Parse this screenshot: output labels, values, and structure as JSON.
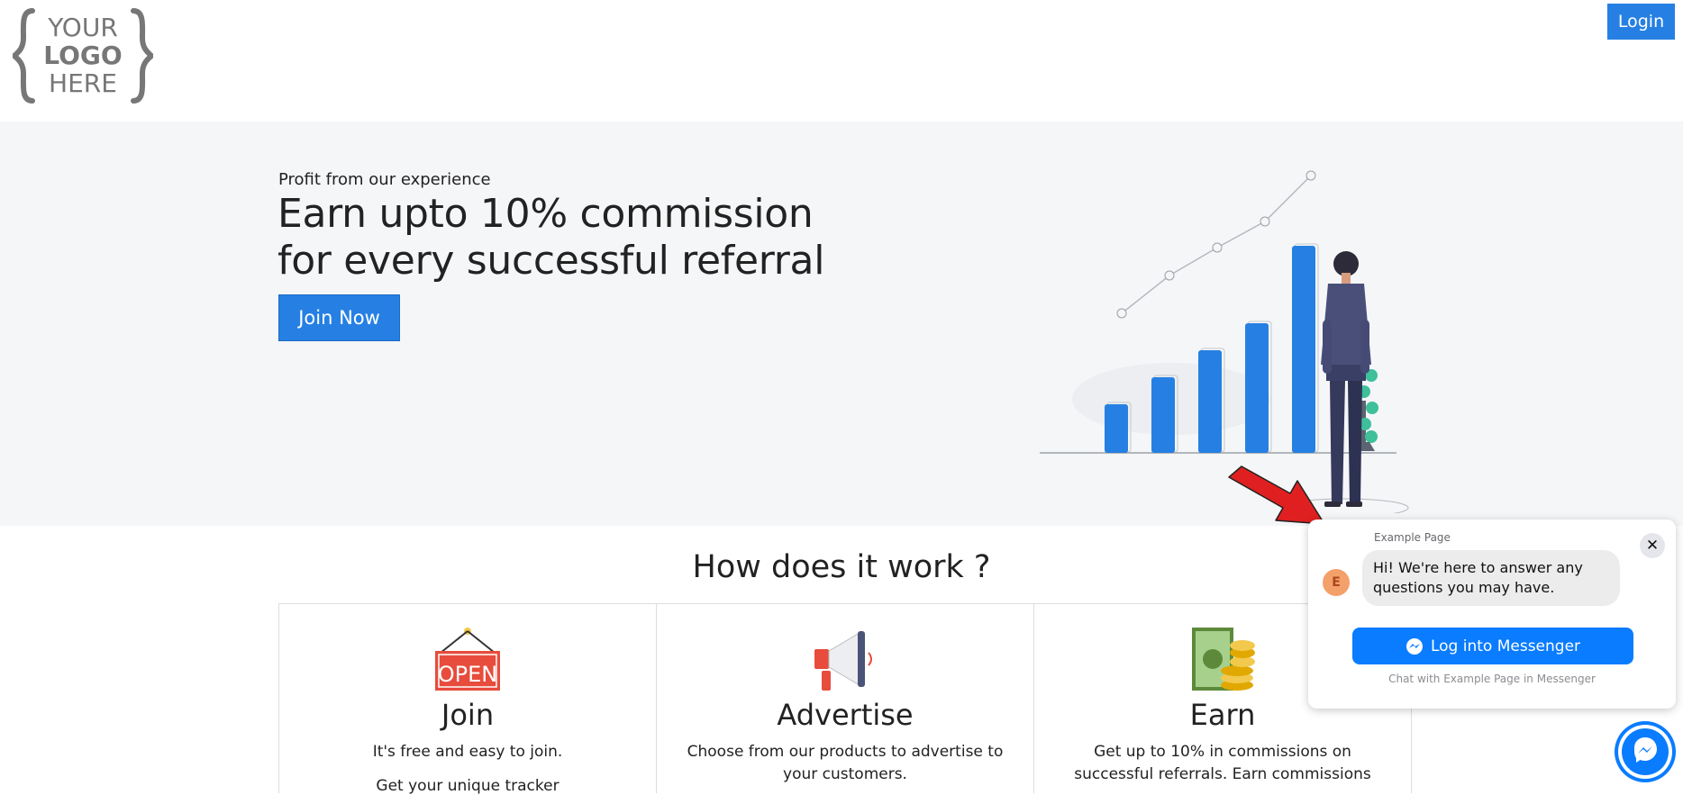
{
  "header": {
    "logo": {
      "line1": "YOUR",
      "line2": "LOGO",
      "line3": "HERE"
    },
    "login_label": "Login"
  },
  "hero": {
    "eyebrow": "Profit from our experience",
    "headline_line1": "Earn upto 10% commission",
    "headline_line2": "for every successful referral",
    "join_label": "Join Now"
  },
  "how": {
    "title": "How does it work ?",
    "cards": [
      {
        "icon": "open-sign-icon",
        "title": "Join",
        "text": "It's free and easy to join.",
        "text2": "Get your unique tracker"
      },
      {
        "icon": "megaphone-icon",
        "title": "Advertise",
        "text": "Choose from our products to advertise to your customers.",
        "text2": ""
      },
      {
        "icon": "money-coins-icon",
        "title": "Earn",
        "text": "Get up to 10% in commissions on successful referrals. Earn commissions",
        "text2": ""
      }
    ]
  },
  "messenger": {
    "page_name": "Example Page",
    "avatar_initial": "E",
    "message": "Hi! We're here to answer any questions you may have.",
    "button_label": "Log into Messenger",
    "note": "Chat with Example Page in Messenger",
    "brand_color": "#0a7cff"
  },
  "colors": {
    "primary": "#2680e3",
    "hero_bg": "#f5f6f8",
    "arrow": "#e02020"
  }
}
